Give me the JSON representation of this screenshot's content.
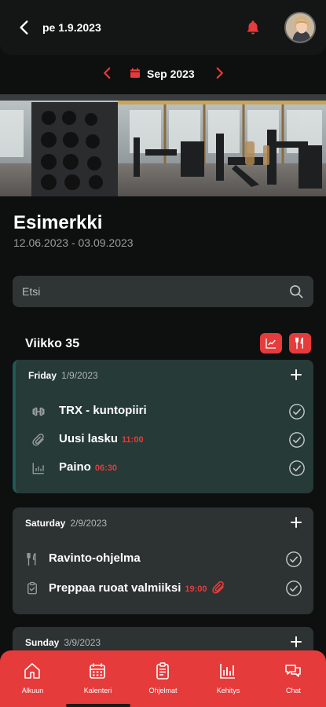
{
  "header": {
    "date_title": "pe 1.9.2023",
    "back_icon": "chevron-left-icon",
    "notification_icon": "bell-icon",
    "accent": "#e63b3b"
  },
  "month_nav": {
    "label": "Sep 2023",
    "prev_icon": "chevron-left-icon",
    "next_icon": "chevron-right-icon",
    "calendar_icon": "calendar-icon"
  },
  "program": {
    "title": "Esimerkki",
    "dates": "12.06.2023 - 03.09.2023"
  },
  "search": {
    "placeholder": "Etsi",
    "value": ""
  },
  "week": {
    "label": "Viikko 35",
    "buttons": [
      "chart-icon",
      "cutlery-icon"
    ]
  },
  "days": [
    {
      "name": "Friday",
      "date": "1/9/2023",
      "items": [
        {
          "icon": "dumbbell-icon",
          "label": "TRX - kuntopiiri",
          "time": ""
        },
        {
          "icon": "paperclip-icon",
          "label": "Uusi lasku",
          "time": "11:00"
        },
        {
          "icon": "chart-icon",
          "label": "Paino",
          "time": "06:30"
        }
      ]
    },
    {
      "name": "Saturday",
      "date": "2/9/2023",
      "items": [
        {
          "icon": "cutlery-icon",
          "label": "Ravinto-ohjelma",
          "time": ""
        },
        {
          "icon": "clipboard-check-icon",
          "label": "Preppaa ruoat valmiiksi",
          "time": "19:00"
        }
      ]
    },
    {
      "name": "Sunday",
      "date": "3/9/2023",
      "items": []
    }
  ],
  "nav": {
    "items": [
      {
        "label": "Alkuun",
        "icon": "home-icon"
      },
      {
        "label": "Kalenteri",
        "icon": "calendar-icon"
      },
      {
        "label": "Ohjelmat",
        "icon": "clipboard-icon"
      },
      {
        "label": "Kehitys",
        "icon": "bar-chart-icon"
      },
      {
        "label": "Chat",
        "icon": "chat-icon"
      }
    ],
    "active_index": 1
  }
}
